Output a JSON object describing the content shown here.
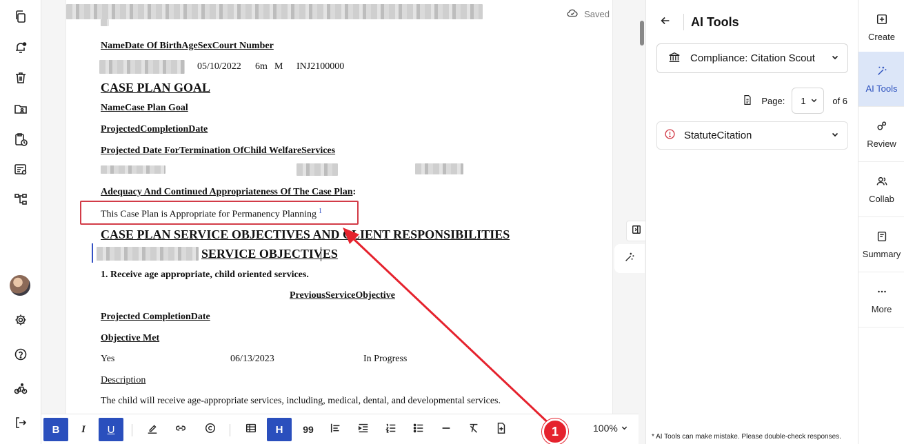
{
  "document": {
    "saved_label": "Saved",
    "table_header": "NameDate Of BirthAgeSexCourt Number",
    "row_dob": "05/10/2022",
    "row_age": "6m",
    "row_sex": "M",
    "row_court": "INJ2100000",
    "case_plan_goal": "CASE PLAN GOAL",
    "name_case_plan_goal": "NameCase Plan Goal",
    "projected_completion_date": "ProjectedCompletionDate",
    "projected_termination": "Projected Date ForTermination OfChild WelfareServices",
    "adequacy_label": "Adequacy And Continued Appropriateness Of The Case Plan",
    "adequacy_colon": ":",
    "appropriate_text": "This Case Plan is Appropriate for Permanency Planning",
    "citation_marker": "1",
    "service_heading": "CASE PLAN SERVICE OBJECTIVES AND CLIENT RESPONSIBILITIES",
    "service_objectives": "SERVICE OBJECTIVES",
    "objective_1": "1. Receive age appropriate, child oriented services.",
    "previous_service_objective": "PreviousServiceObjective",
    "projected_completion_date_2": "Projected CompletionDate",
    "objective_met": "Objective Met",
    "met_value": "Yes",
    "met_date": "06/13/2023",
    "met_status": "In Progress",
    "description_label": "Description",
    "description_text": "The child will receive age-appropriate services, including, medical, dental, and developmental services."
  },
  "annotation": {
    "step_number": "1",
    "accent_color": "#e5222d"
  },
  "toolbar": {
    "bold": "B",
    "italic": "I",
    "underline": "U",
    "heading": "H",
    "quote": "99",
    "zoom": "100%"
  },
  "ai_panel": {
    "title": "AI Tools",
    "tool_selected": "Compliance: Citation Scout",
    "page_label": "Page:",
    "page_value": "1",
    "page_of": "of 6",
    "statute_label": "StatuteCitation",
    "disclaimer": "* AI Tools can make mistake. Please double-check responses."
  },
  "right_rail": {
    "items": [
      {
        "label": "Create",
        "icon": "plus-square-icon"
      },
      {
        "label": "AI Tools",
        "icon": "magic-wand-icon"
      },
      {
        "label": "Review",
        "icon": "review-icon"
      },
      {
        "label": "Collab",
        "icon": "users-icon"
      },
      {
        "label": "Summary",
        "icon": "document-icon"
      },
      {
        "label": "More",
        "icon": "more-icon"
      }
    ]
  },
  "colors": {
    "primary": "#2a4fbd",
    "active_bg": "#dce6f8",
    "error_red": "#d23b47"
  }
}
